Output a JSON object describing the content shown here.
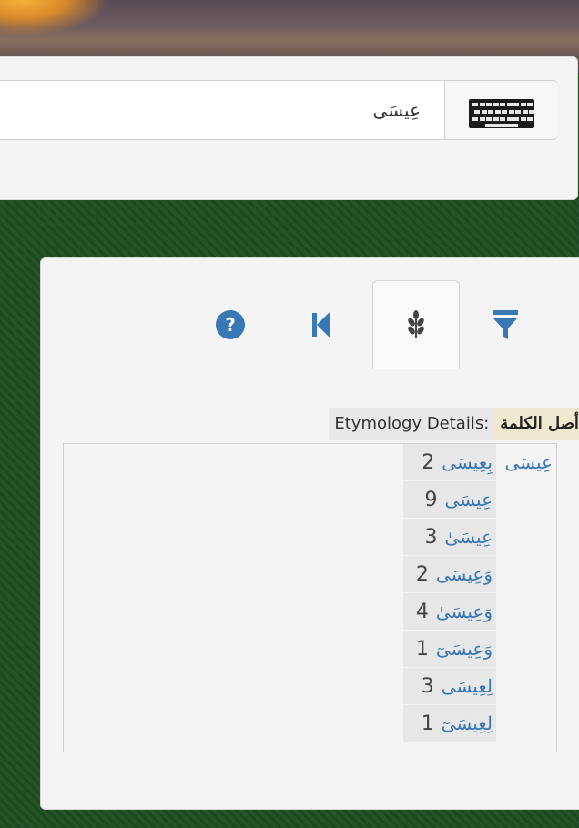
{
  "search": {
    "value": "عِيسَى"
  },
  "tabs": [
    {
      "name": "filter",
      "icon": "filter-icon"
    },
    {
      "name": "etymology",
      "icon": "wheat-icon",
      "active": true
    },
    {
      "name": "first",
      "icon": "first-page-icon"
    },
    {
      "name": "help",
      "icon": "help-icon"
    }
  ],
  "etymology": {
    "label_ar": "أصل الكلمة",
    "label_en": "Etymology Details:",
    "colon": ":",
    "root": "عِيسَى",
    "forms": [
      {
        "word": "بِعِيسَى",
        "count": "2"
      },
      {
        "word": "عِيسَى",
        "count": "9"
      },
      {
        "word": "عِيسَىٰ",
        "count": "3"
      },
      {
        "word": "وَعِيسَى",
        "count": "2"
      },
      {
        "word": "وَعِيسَىٰ",
        "count": "4"
      },
      {
        "word": "وَعِيسَىٓ",
        "count": "1"
      },
      {
        "word": "لِعِيسَى",
        "count": "3"
      },
      {
        "word": "لِعِيسَىٓ",
        "count": "1"
      }
    ]
  },
  "colors": {
    "accent": "#3a78b5",
    "panel": "#f4f4f4",
    "background": "#1e4d1f"
  }
}
